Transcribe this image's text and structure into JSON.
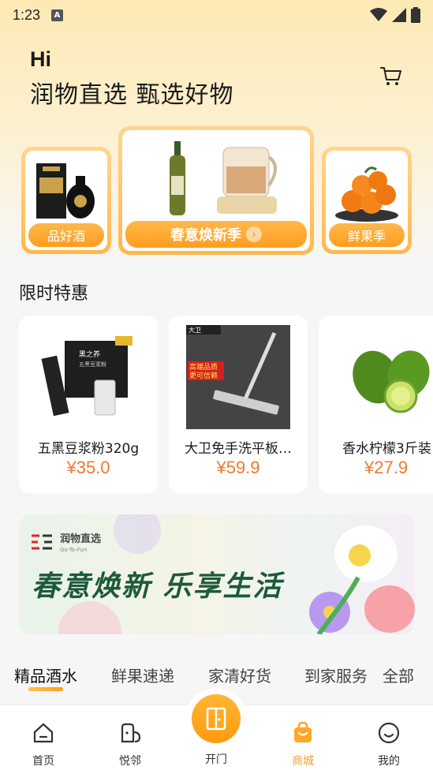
{
  "status_bar": {
    "time": "1:23",
    "badge": "A"
  },
  "header": {
    "greeting": "Hi",
    "slogan": "润物直选 甄选好物"
  },
  "categories": [
    {
      "label": "品好酒"
    },
    {
      "label": "春意焕新季"
    },
    {
      "label": "鲜果季"
    }
  ],
  "deals": {
    "title": "限时特惠",
    "items": [
      {
        "name": "五黑豆浆粉320g",
        "price": "¥35.0"
      },
      {
        "name": "大卫免手洗平板…",
        "price": "¥59.9"
      },
      {
        "name": "香水柠檬3斤装",
        "price": "¥27.9"
      }
    ],
    "mop_tag1": "高端品质",
    "mop_tag2": "更可信赖",
    "mop_brand": "大卫",
    "soy_brand": "黑之养",
    "soy_sub": "五黑豆浆粉"
  },
  "banner": {
    "brand_name": "润物直选",
    "brand_sub": "Go-To-Fun",
    "headline": "春意焕新  乐享生活"
  },
  "tabs": [
    {
      "label": "精品酒水"
    },
    {
      "label": "鲜果速递"
    },
    {
      "label": "家清好货"
    },
    {
      "label": "到家服务"
    },
    {
      "label": "全部"
    }
  ],
  "bottom_nav": {
    "home": "首页",
    "neighbor": "悦邻",
    "open_door": "开门",
    "mall": "商城",
    "mine": "我的"
  },
  "colors": {
    "accent": "#ff9d1f",
    "price": "#f07a2e"
  }
}
